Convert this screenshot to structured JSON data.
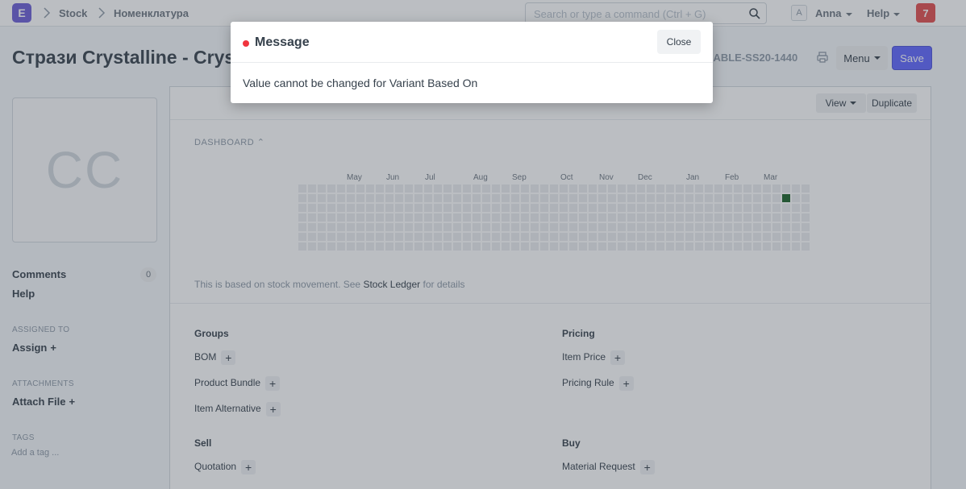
{
  "navbar": {
    "logo": "E",
    "breadcrumbs": [
      "Stock",
      "Номенклатура"
    ],
    "search_placeholder": "Search or type a command (Ctrl + G)",
    "avatar_letter": "A",
    "user": "Anna",
    "help": "Help",
    "notifications": "7"
  },
  "page": {
    "title": "Стрази Crystalline - Crys",
    "item_code": "ysABLE-SS20-1440",
    "menu_label": "Menu",
    "save_label": "Save"
  },
  "sidebar": {
    "image_initials": "CC",
    "comments": "Comments",
    "comments_count": "0",
    "help": "Help",
    "assigned_to_label": "ASSIGNED TO",
    "assign": "Assign",
    "attachments_label": "ATTACHMENTS",
    "attach_file": "Attach File",
    "tags_label": "TAGS",
    "tag_placeholder": "Add a tag ..."
  },
  "form": {
    "view_label": "View",
    "duplicate_label": "Duplicate",
    "dashboard_label": "DASHBOARD",
    "months": [
      "May",
      "Jun",
      "Jul",
      "Aug",
      "Sep",
      "Oct",
      "Nov",
      "Dec",
      "Jan",
      "Feb",
      "Mar"
    ],
    "note_prefix": "This is based on stock movement. See ",
    "note_link": "Stock Ledger",
    "note_suffix": " for details",
    "groups_title": "Groups",
    "groups": [
      "BOM",
      "Product Bundle",
      "Item Alternative"
    ],
    "pricing_title": "Pricing",
    "pricing": [
      "Item Price",
      "Pricing Rule"
    ],
    "sell_title": "Sell",
    "sell": [
      "Quotation"
    ],
    "buy_title": "Buy",
    "buy": [
      "Material Request"
    ]
  },
  "modal": {
    "title": "Message",
    "close_label": "Close",
    "body": "Value cannot be changed for Variant Based On"
  },
  "colors": {
    "brand": "#6a5cd6",
    "primary": "#5e64ff",
    "indicator_red": "#f0353e",
    "heat_empty": "#ebedf0",
    "heat_active": "#196127"
  }
}
